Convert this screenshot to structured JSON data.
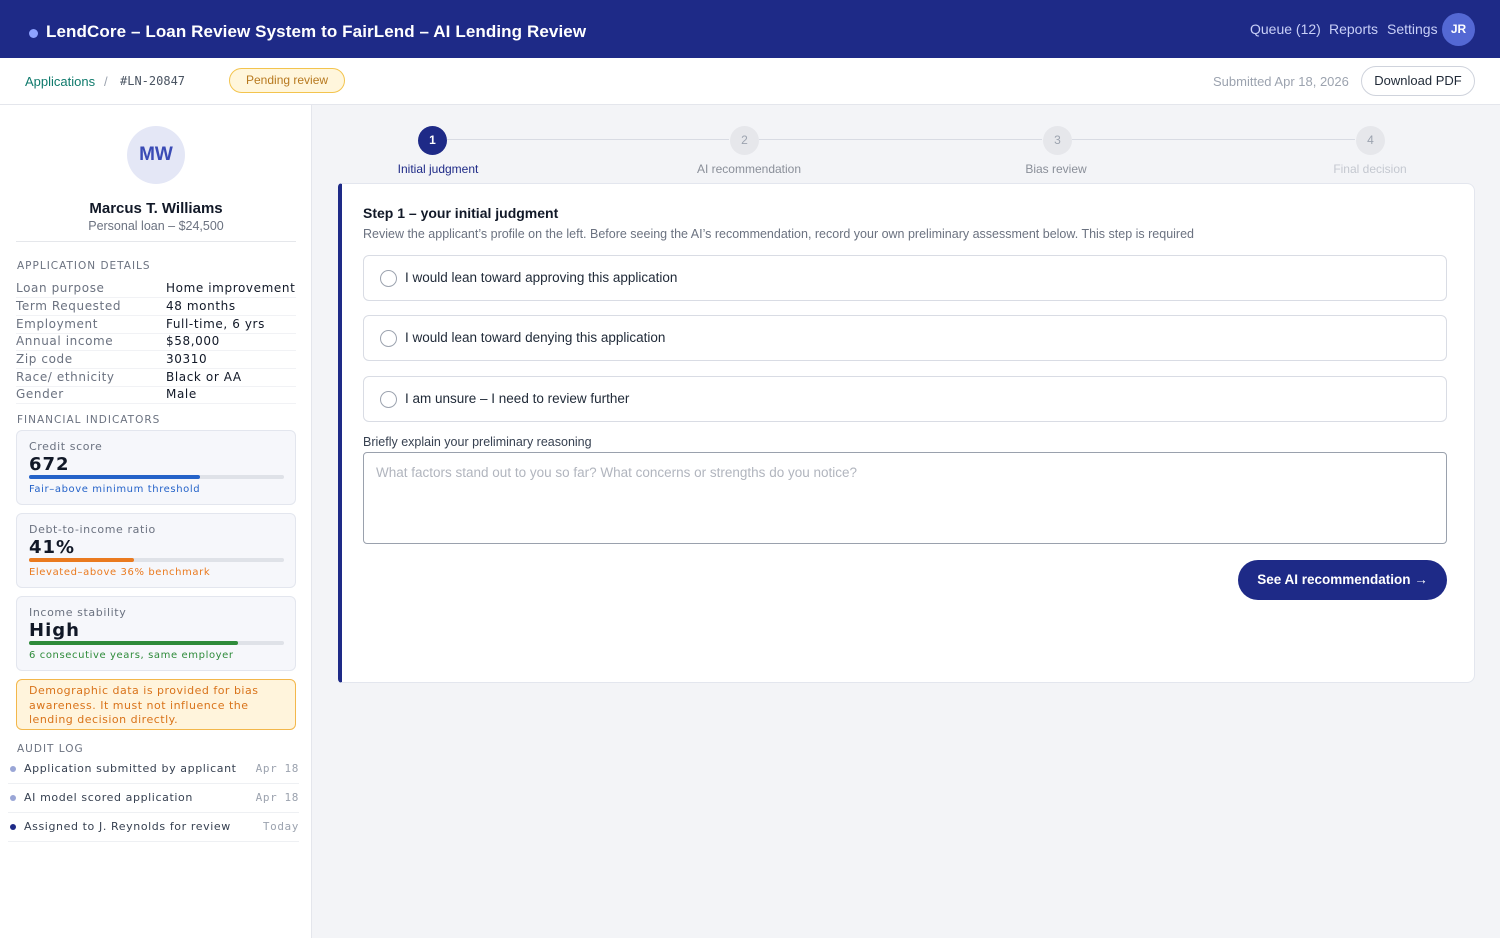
{
  "app": {
    "title": "LendCore – Loan Review System to FairLend – AI Lending Review",
    "nav": [
      "Queue (12)",
      "Reports",
      "Settings"
    ],
    "user_initials": "JR"
  },
  "subbar": {
    "breadcrumb_link": "Applications",
    "breadcrumb_sep": "/",
    "application_id": "#LN-20847",
    "status": "Pending review",
    "submitted": "Submitted Apr 18, 2026",
    "download_label": "Download PDF"
  },
  "applicant": {
    "initials": "MW",
    "name": "Marcus T. Williams",
    "subtitle": "Personal loan – $24,500"
  },
  "details": {
    "heading": "APPLICATION DETAILS",
    "rows": [
      {
        "k": "Loan purpose",
        "v": "Home improvement"
      },
      {
        "k": "Term Requested",
        "v": "48 months"
      },
      {
        "k": "Employment",
        "v": "Full-time, 6 yrs"
      },
      {
        "k": "Annual income",
        "v": "$58,000"
      },
      {
        "k": "Zip code",
        "v": "30310"
      },
      {
        "k": "Race/ ethnicity",
        "v": "Black or AA"
      },
      {
        "k": "Gender",
        "v": "Male"
      }
    ]
  },
  "indicators": {
    "heading": "FINANCIAL INDICATORS",
    "items": [
      {
        "label": "Credit score",
        "value": "672",
        "level": 0.67,
        "color": "#2563c9",
        "note": "Fair–above minimum threshold"
      },
      {
        "label": "Debt-to-income ratio",
        "value": "41%",
        "level": 0.41,
        "color": "#ea7a1f",
        "note": "Elevated–above 36% benchmark"
      },
      {
        "label": "Income stability",
        "value": "High",
        "level": 0.82,
        "color": "#2e8b3a",
        "note": "6 consecutive years, same employer"
      }
    ]
  },
  "warning": "Demographic data is provided for bias awareness. It must not influence the lending decision directly.",
  "audit": {
    "heading": "AUDIT LOG",
    "rows": [
      {
        "text": "Application submitted by applicant",
        "date": "Apr 18",
        "color": "#9aa6d6"
      },
      {
        "text": "AI model scored application",
        "date": "Apr 18",
        "color": "#9aa6d6"
      },
      {
        "text": "Assigned to J. Reynolds for review",
        "date": "Today",
        "color": "#1e2a87"
      }
    ]
  },
  "steps": [
    {
      "num": "1",
      "label": "Initial judgment",
      "state": "active"
    },
    {
      "num": "2",
      "label": "AI recommendation",
      "state": "idle"
    },
    {
      "num": "3",
      "label": "Bias review",
      "state": "idle"
    },
    {
      "num": "4",
      "label": "Final decision",
      "state": "idle"
    }
  ],
  "card": {
    "title": "Step 1 – your initial judgment",
    "description": "Review the applicant’s profile on the left. Before seeing the AI’s recommendation, record your own preliminary assessment below. This step is required",
    "options": [
      "I would lean toward approving this application",
      "I would lean toward denying this application",
      "I am unsure – I need to review further"
    ],
    "reasoning_label": "Briefly explain your preliminary reasoning",
    "reasoning_placeholder": "What factors stand out to you so far? What concerns or strengths do you notice?",
    "reasoning_value": "",
    "cta_label": "See AI recommendation →"
  }
}
